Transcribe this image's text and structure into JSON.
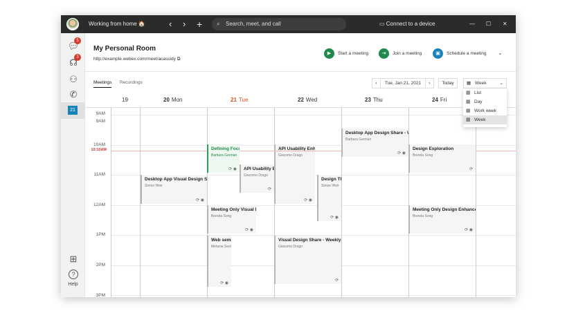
{
  "titlebar": {
    "status": "Working from home 🏠",
    "search_placeholder": "Search, meet, and call",
    "connect": "Connect to a device"
  },
  "sidebar": {
    "messages_badge": "5",
    "teams_badge": "3",
    "calendar_day": "21",
    "help": "Help"
  },
  "header": {
    "title": "My Personal Room",
    "url": "http://example.webex.com/meet/acassidy",
    "start": "Start a meeting",
    "join": "Join a meeting",
    "schedule": "Schedule a meeting"
  },
  "tabs": [
    "Meetings",
    "Recordings"
  ],
  "date_nav": {
    "date": "Tue, Jan 21, 2021",
    "today": "Today",
    "view": "Week"
  },
  "view_options": [
    "List",
    "Day",
    "Work week",
    "Week"
  ],
  "days": [
    {
      "num": "19",
      "name": ""
    },
    {
      "num": "20",
      "name": "Mon"
    },
    {
      "num": "21",
      "name": "Tue"
    },
    {
      "num": "22",
      "name": "Wed"
    },
    {
      "num": "23",
      "name": "Thu"
    },
    {
      "num": "24",
      "name": "Fri"
    }
  ],
  "times": [
    "9AM",
    "9AM",
    "10AM",
    "11AM",
    "12AM",
    "1PM",
    "2PM",
    "3PM"
  ],
  "now": "10:10AM",
  "colors": {
    "accent_green": "#2aa05a",
    "today": "#c5571c",
    "badge": "#d93b2b"
  },
  "events": [
    {
      "title": "Desktop App Visual Design Sync",
      "person": "Simon Weir",
      "icons": "⟳ ◉"
    },
    {
      "title": "Defining Focus",
      "person": "Barbara German",
      "icons": "⟳ ◉"
    },
    {
      "title": "API Usability Enhancements",
      "person": "Giacomo Drago",
      "icons": "⟳"
    },
    {
      "title": "Meeting Only Visual Design",
      "person": "Brenda Song",
      "icons": "⟳ ◉"
    },
    {
      "title": "Web seminar",
      "person": "Melania Seeley",
      "icons": "⟳ ◉"
    },
    {
      "title": "API Usability Enhancements",
      "person": "Giacomo Drago",
      "icons": "⟳ ◉"
    },
    {
      "title": "Design Thinking",
      "person": "Simon Weir",
      "icons": "⟳ ◉"
    },
    {
      "title": "Visual Design Share - Weekly",
      "person": "Giacomo Drago",
      "icons": "⟳"
    },
    {
      "title": "Desktop App Design Share - Weekly",
      "person": "Barbara German",
      "icons": "⟳ ◉"
    },
    {
      "title": "Design Exploration",
      "person": "Brenda Song",
      "icons": "⟳"
    },
    {
      "title": "Meeting Only Design Enhancements",
      "person": "Brenda Song",
      "icons": "⟳ ◉"
    }
  ]
}
